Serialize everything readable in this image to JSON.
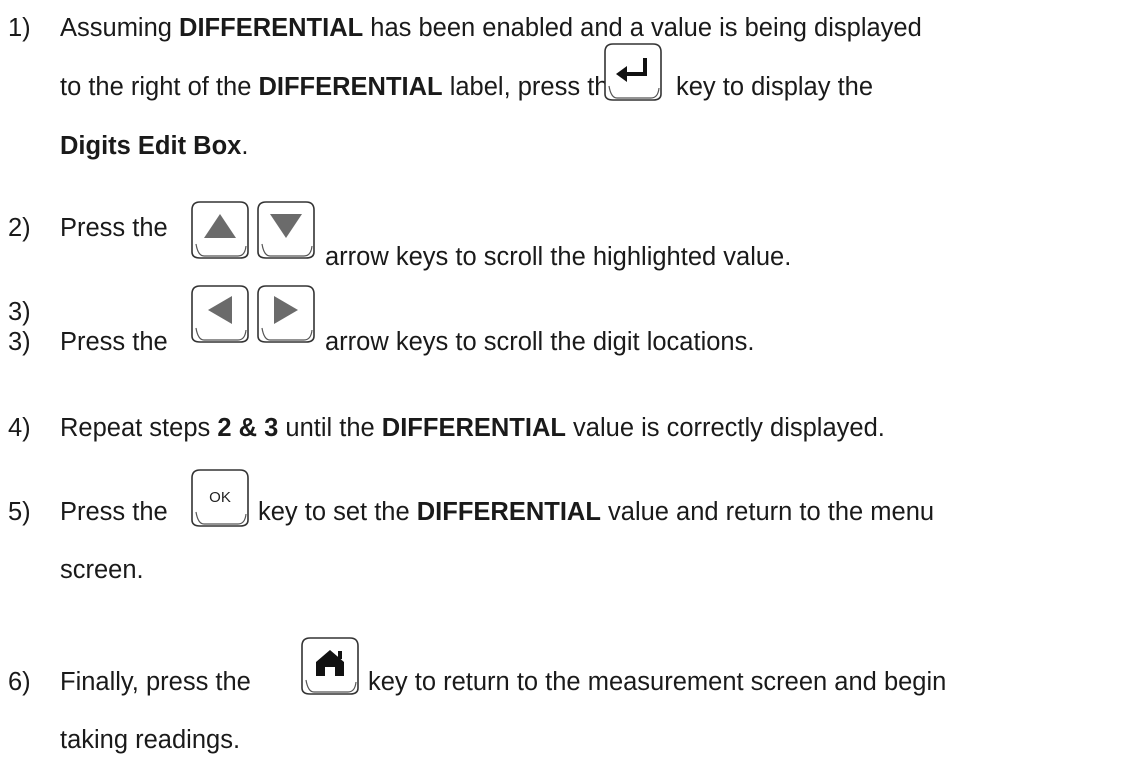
{
  "steps": [
    {
      "num": "1)",
      "l1_a": "Assuming ",
      "l1_b": "DIFFERENTIAL",
      "l1_c": " has been enabled and a value is being displayed",
      "l2_a": "to the right of the ",
      "l2_b": "DIFFERENTIAL",
      "l2_c": " label, press the",
      "l2_d": "key to display the",
      "l3_a": "Digits Edit Box",
      "l3_b": ".",
      "key": "enter-key"
    },
    {
      "num": "2)",
      "a": "Press the",
      "b": "arrow keys to scroll the highlighted value.",
      "keys": [
        "up-arrow-key",
        "down-arrow-key"
      ]
    },
    {
      "num": "3)",
      "a": "Press the",
      "b": "arrow keys to scroll the digit locations.",
      "keys": [
        "left-arrow-key",
        "right-arrow-key"
      ]
    },
    {
      "num": "4)",
      "a": "Repeat steps ",
      "b": "2 & 3",
      "c": " until the ",
      "d": "DIFFERENTIAL",
      "e": " value is correctly displayed."
    },
    {
      "num": "5)",
      "a": "Press the",
      "key_label": "OK",
      "b": "key to set the ",
      "c": "DIFFERENTIAL",
      "d": " value and return to the menu",
      "l2": "screen."
    },
    {
      "num": "6)",
      "a": "Finally, press the",
      "b": "key to return to the measurement screen and begin",
      "l2": "taking readings.",
      "key": "home-key"
    }
  ]
}
